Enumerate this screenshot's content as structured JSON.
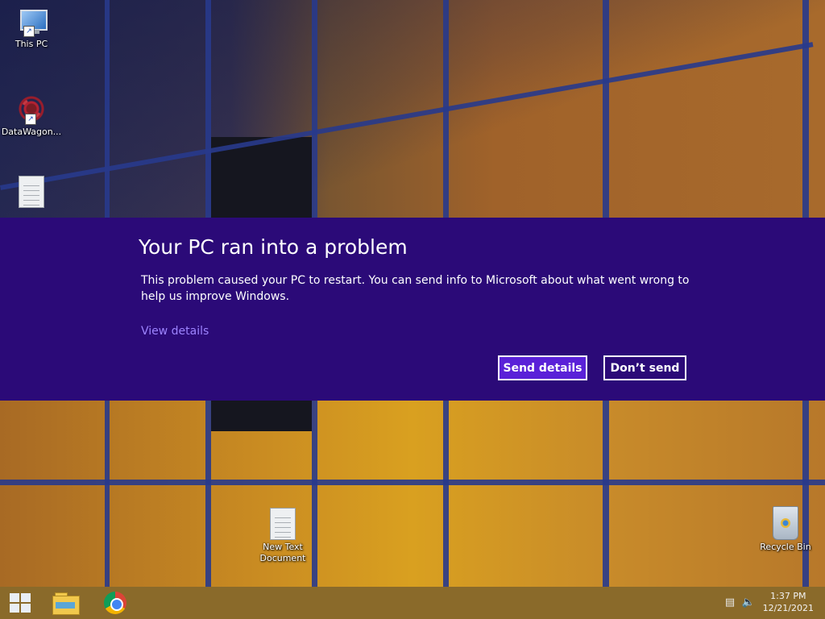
{
  "desktop": {
    "icons": [
      {
        "label": "This PC",
        "icon": "this-pc-icon"
      },
      {
        "label": "DataWagon...",
        "icon": "datawagon-icon"
      },
      {
        "label": "",
        "icon": "text-document-icon"
      },
      {
        "label": "New Text Document",
        "icon": "text-document-icon"
      },
      {
        "label": "Recycle Bin",
        "icon": "recycle-bin-icon"
      }
    ]
  },
  "error_dialog": {
    "title": "Your PC ran into a problem",
    "message": "This problem caused your PC to restart. You can send info to Microsoft about what went wrong to help us improve Windows.",
    "view_details": "View details",
    "send_button": "Send details",
    "dont_send_button": "Don’t send",
    "colors": {
      "background": "#2b0a78",
      "link": "#9d84ff",
      "primary_button": "#5a21d8"
    }
  },
  "taskbar": {
    "start_icon": "windows-logo-icon",
    "pinned": [
      {
        "name": "File Explorer",
        "icon": "file-explorer-icon"
      },
      {
        "name": "Google Chrome",
        "icon": "chrome-icon"
      }
    ],
    "tray": {
      "network_icon": "network-icon",
      "volume_icon": "volume-icon",
      "time": "1:37 PM",
      "date": "12/21/2021"
    }
  }
}
